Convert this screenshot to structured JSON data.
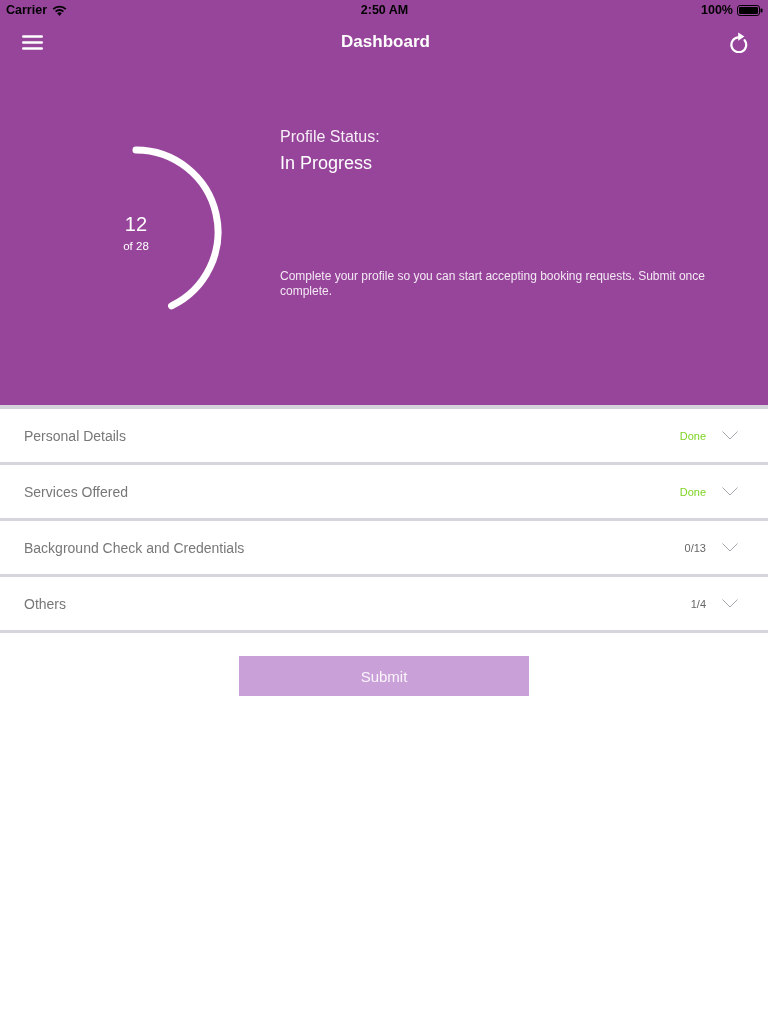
{
  "status_bar": {
    "carrier": "Carrier",
    "time": "2:50 AM",
    "battery": "100%"
  },
  "nav_bar": {
    "title": "Dashboard"
  },
  "profile": {
    "completed": "12",
    "total_label": "of 28",
    "level": 0.4286,
    "status_label": "Profile Status:",
    "status": "In Progress",
    "description": "Complete your profile so you can start accepting booking requests. Submit once complete."
  },
  "sections": [
    {
      "title": "Personal Details",
      "status": "Done",
      "kind": "done",
      "expanded": false
    },
    {
      "title": "Services Offered",
      "status": "Done",
      "kind": "done",
      "expanded": false
    },
    {
      "title": "Background Check and Credentials",
      "status": "0/13",
      "kind": "count",
      "expanded": false
    },
    {
      "title": "Others",
      "status": "1/4",
      "kind": "count",
      "expanded": false
    }
  ],
  "submit_button": {
    "label": "Submit",
    "disabled": true
  }
}
